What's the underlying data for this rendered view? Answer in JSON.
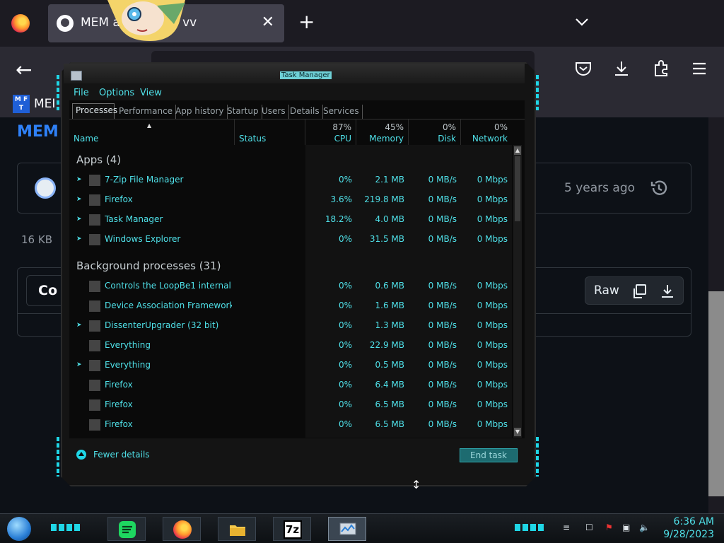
{
  "browser": {
    "tab_title": "MEM          at master · vv",
    "tab_close": "✕",
    "new_tab": "+",
    "back": "←",
    "bookmark_icon_text": "M F T",
    "bookmark_label": "MEI"
  },
  "github": {
    "heading": "MEM",
    "commit_age": "5 years ago",
    "file_size": "16  KB",
    "code_button": "Co",
    "raw_button": "Raw"
  },
  "taskmanager": {
    "title": "Task Manager",
    "menu": [
      "File",
      "Options",
      "View"
    ],
    "tabs": [
      "Processes",
      "Performance",
      "App history",
      "Startup",
      "Users",
      "Details",
      "Services"
    ],
    "columns": {
      "name": "Name",
      "status": "Status",
      "cpu": {
        "pct": "87%",
        "label": "CPU"
      },
      "memory": {
        "pct": "45%",
        "label": "Memory"
      },
      "disk": {
        "pct": "0%",
        "label": "Disk"
      },
      "network": {
        "pct": "0%",
        "label": "Network"
      }
    },
    "apps_group": "Apps (4)",
    "apps": [
      {
        "name": "7-Zip File Manager",
        "cpu": "0%",
        "memory": "2.1 MB",
        "disk": "0 MB/s",
        "network": "0 Mbps"
      },
      {
        "name": "Firefox",
        "cpu": "3.6%",
        "memory": "219.8 MB",
        "disk": "0 MB/s",
        "network": "0 Mbps"
      },
      {
        "name": "Task Manager",
        "cpu": "18.2%",
        "memory": "4.0 MB",
        "disk": "0 MB/s",
        "network": "0 Mbps"
      },
      {
        "name": "Windows Explorer",
        "cpu": "0%",
        "memory": "31.5 MB",
        "disk": "0 MB/s",
        "network": "0 Mbps"
      }
    ],
    "bg_group": "Background processes (31)",
    "background": [
      {
        "name": "Controls the LoopBe1 internal ...",
        "cpu": "0%",
        "memory": "0.6 MB",
        "disk": "0 MB/s",
        "network": "0 Mbps"
      },
      {
        "name": "Device Association Framework ...",
        "cpu": "0%",
        "memory": "1.6 MB",
        "disk": "0 MB/s",
        "network": "0 Mbps"
      },
      {
        "name": "DissenterUpgrader (32 bit)",
        "cpu": "0%",
        "memory": "1.3 MB",
        "disk": "0 MB/s",
        "network": "0 Mbps"
      },
      {
        "name": "Everything",
        "cpu": "0%",
        "memory": "22.9 MB",
        "disk": "0 MB/s",
        "network": "0 Mbps"
      },
      {
        "name": "Everything",
        "cpu": "0%",
        "memory": "0.5 MB",
        "disk": "0 MB/s",
        "network": "0 Mbps"
      },
      {
        "name": "Firefox",
        "cpu": "0%",
        "memory": "6.4 MB",
        "disk": "0 MB/s",
        "network": "0 Mbps"
      },
      {
        "name": "Firefox",
        "cpu": "0%",
        "memory": "6.5 MB",
        "disk": "0 MB/s",
        "network": "0 Mbps"
      },
      {
        "name": "Firefox",
        "cpu": "0%",
        "memory": "6.5 MB",
        "disk": "0 MB/s",
        "network": "0 Mbps"
      }
    ],
    "fewer_details": "Fewer details",
    "end_task": "End task"
  },
  "taskbar": {
    "apps": [
      "spotify-icon",
      "firefox-icon",
      "file-explorer-icon",
      "7zip-icon",
      "task-manager-icon"
    ],
    "sevenzip_label": "7z",
    "time": "6:36 AM",
    "date": "9/28/2023"
  },
  "colors": {
    "accent": "#4fe0e8",
    "glow": "#1fd6e6",
    "github_link": "#2f81f7"
  }
}
